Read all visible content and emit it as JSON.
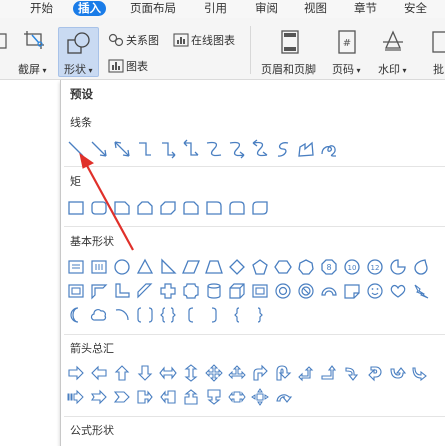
{
  "tabs": [
    {
      "label": "开始"
    },
    {
      "label": "插入",
      "active": true
    },
    {
      "label": "页面布局"
    },
    {
      "label": "引用"
    },
    {
      "label": "审阅"
    },
    {
      "label": "视图"
    },
    {
      "label": "章节"
    },
    {
      "label": "安全"
    }
  ],
  "ribbon": {
    "screenshot_label": "截屏",
    "shapes_label": "形状",
    "relation_label": "关系图",
    "online_chart_label": "在线图表",
    "chart_label": "图表",
    "header_footer_label": "页眉和页脚",
    "page_number_label": "页码",
    "watermark_label": "水印",
    "batch_label": "批"
  },
  "panel": {
    "title": "预设",
    "sections": {
      "lines": "线条",
      "rect": "矩",
      "basic": "基本形状",
      "arrows": "箭头总汇",
      "formula": "公式形状"
    }
  },
  "icons": {
    "lines": [
      "line-icon",
      "arrow-line-icon",
      "double-arrow-line-icon",
      "elbow-connector-icon",
      "elbow-arrow-connector-icon",
      "elbow-double-arrow-connector-icon",
      "curved-connector-icon",
      "curved-arrow-connector-icon",
      "curved-double-arrow-connector-icon",
      "curve-icon",
      "freeform-icon",
      "scribble-icon"
    ],
    "rects": [
      "rectangle-icon",
      "rounded-rectangle-icon",
      "snip-corner-rectangle-icon",
      "snip-same-side-rectangle-icon",
      "snip-diagonal-rectangle-icon",
      "snip-round-rectangle-icon",
      "round-corner-rectangle-icon",
      "round-same-side-rectangle-icon",
      "round-diagonal-rectangle-icon"
    ],
    "basic": [
      "text-box-icon",
      "vertical-text-box-icon",
      "oval-icon",
      "triangle-icon",
      "right-triangle-icon",
      "parallelogram-icon",
      "trapezoid-icon",
      "diamond-icon",
      "pentagon-icon",
      "hexagon-icon",
      "heptagon-icon",
      "octagon-icon",
      "decagon-icon",
      "dodecagon-icon",
      "pie-icon",
      "teardrop-icon"
    ],
    "accent": "#4a7fc1"
  },
  "annotation": {
    "color": "#e0302a"
  }
}
